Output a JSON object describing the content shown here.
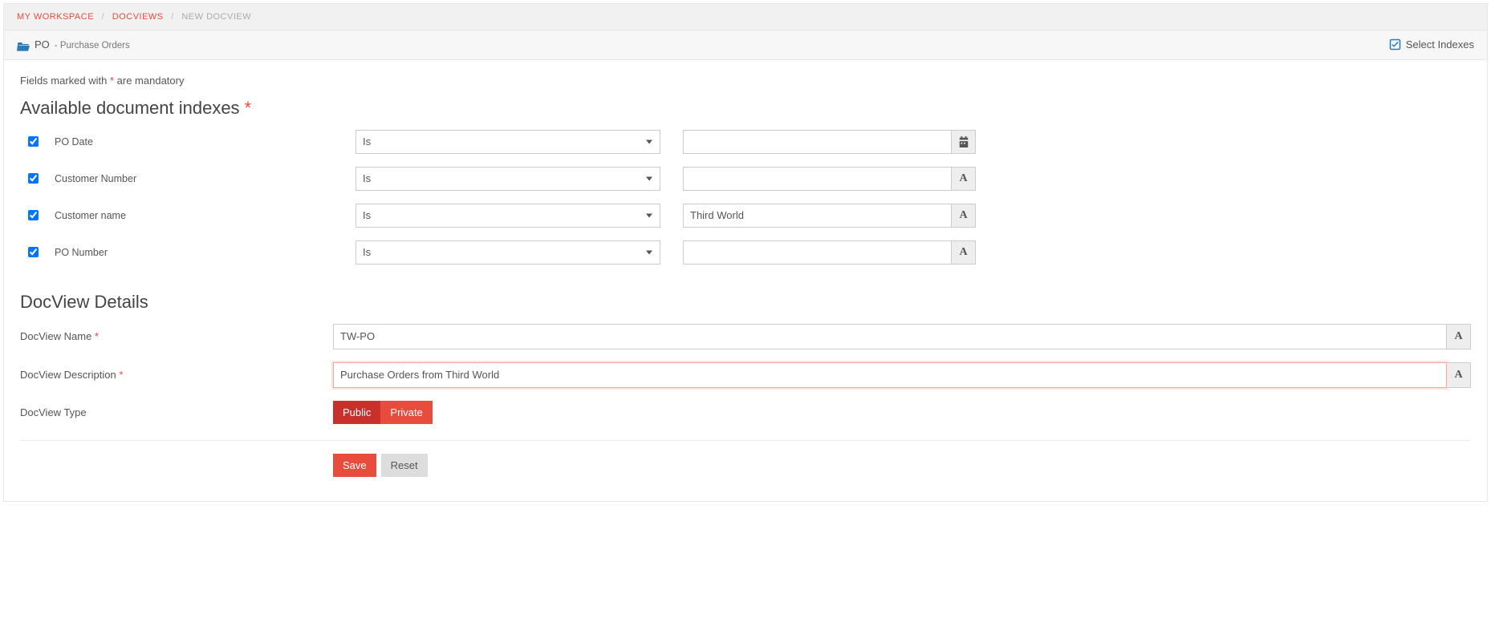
{
  "breadcrumb": {
    "items": [
      "MY WORKSPACE",
      "DOCVIEWS"
    ],
    "current": "NEW DOCVIEW"
  },
  "panel": {
    "folder_code": "PO",
    "folder_sep": " - ",
    "folder_desc": "Purchase Orders",
    "select_indexes_label": "Select Indexes"
  },
  "hint": {
    "prefix": "Fields marked with ",
    "suffix": " are mandatory",
    "marker": "*"
  },
  "sections": {
    "indexes_title": "Available document indexes ",
    "details_title": "DocView Details"
  },
  "indexes": [
    {
      "label": "PO Date",
      "checked": true,
      "operator": "Is",
      "value": "",
      "type": "date"
    },
    {
      "label": "Customer Number",
      "checked": true,
      "operator": "Is",
      "value": "",
      "type": "text"
    },
    {
      "label": "Customer name",
      "checked": true,
      "operator": "Is",
      "value": "Third World",
      "type": "text"
    },
    {
      "label": "PO Number",
      "checked": true,
      "operator": "Is",
      "value": "",
      "type": "text"
    }
  ],
  "details": {
    "name_label": "DocView Name ",
    "name_value": "TW-PO",
    "desc_label": "DocView Description ",
    "desc_value": "Purchase Orders from Third World",
    "type_label": "DocView Type",
    "type_public": "Public",
    "type_private": "Private"
  },
  "actions": {
    "save": "Save",
    "reset": "Reset"
  },
  "marker": "*"
}
